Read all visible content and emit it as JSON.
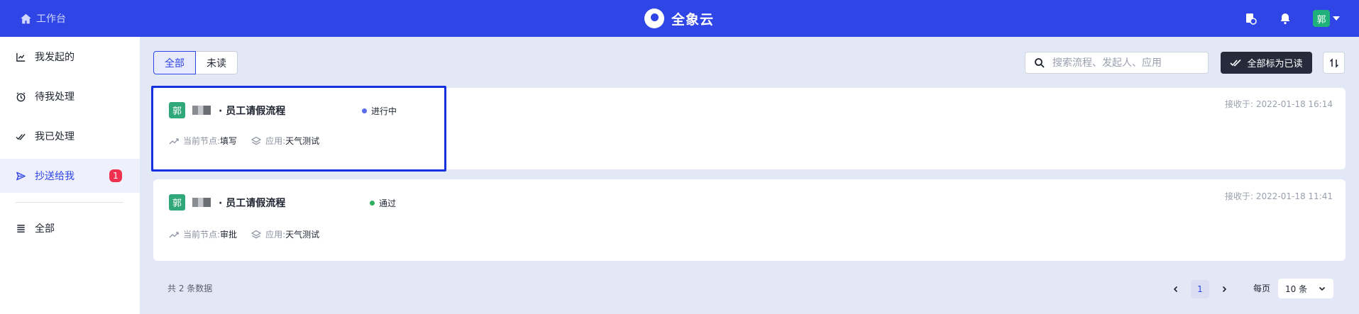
{
  "header": {
    "workbench_label": "工作台",
    "brand_name": "全象云",
    "user_avatar_text": "郭"
  },
  "sidebar": {
    "items": [
      {
        "label": "我发起的",
        "icon": "chart-icon"
      },
      {
        "label": "待我处理",
        "icon": "clock-icon"
      },
      {
        "label": "我已处理",
        "icon": "double-check-icon"
      },
      {
        "label": "抄送给我",
        "icon": "send-icon",
        "badge": "1"
      },
      {
        "label": "全部",
        "icon": "list-icon"
      }
    ]
  },
  "toolbar": {
    "tabs": [
      "全部",
      "未读"
    ],
    "search_placeholder": "搜索流程、发起人、应用",
    "mark_all_read_label": "全部标为已读"
  },
  "cards": [
    {
      "avatar_text": "郭",
      "title": "· 员工请假流程",
      "status": "进行中",
      "status_color": "#5a6cf0",
      "received": "接收于: 2022-01-18 16:14",
      "node_label": "当前节点:",
      "node_value": "填写",
      "app_label": "应用:",
      "app_value": "天气测试"
    },
    {
      "avatar_text": "郭",
      "title": "· 员工请假流程",
      "status": "通过",
      "status_color": "#2fae5e",
      "received": "接收于: 2022-01-18 11:41",
      "node_label": "当前节点:",
      "node_value": "审批",
      "app_label": "应用:",
      "app_value": "天气测试"
    }
  ],
  "footer": {
    "total_text": "共 2 条数据",
    "current_page": "1",
    "per_page_label": "每页",
    "per_page_value": "10 条"
  },
  "colors": {
    "primary": "#2f45e5",
    "badge": "#f0304f",
    "avatar": "#30a879"
  }
}
